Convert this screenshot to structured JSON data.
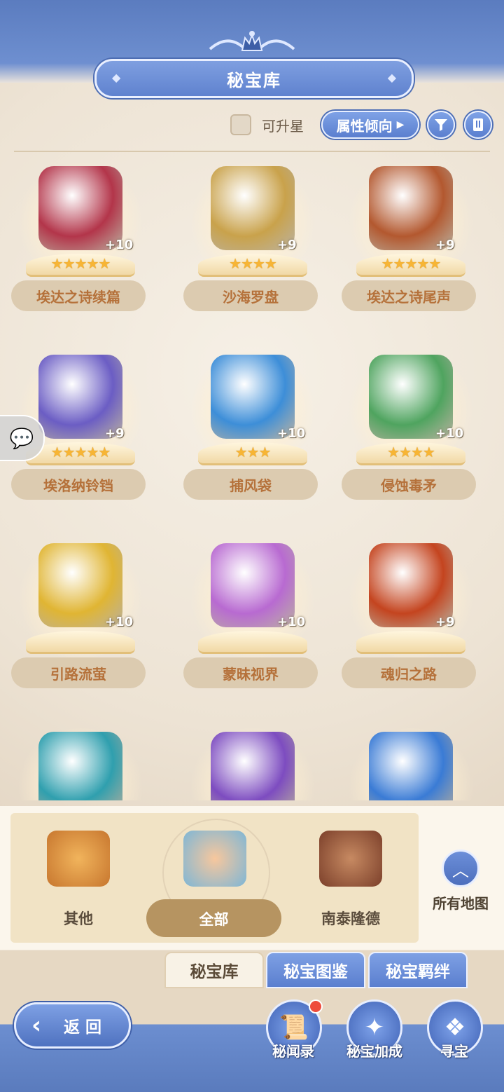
{
  "header": {
    "title": "秘宝库"
  },
  "filters": {
    "upgradable_label": "可升星",
    "attribute_label": "属性倾向",
    "filter_icon": "filter-icon",
    "sort_icon": "bookmark-icon"
  },
  "items": [
    {
      "name": "埃达之诗续篇",
      "level": "+10",
      "stars": "★★★★★",
      "icon": "red-book-icon",
      "color": "#b3354a"
    },
    {
      "name": "沙海罗盘",
      "level": "+9",
      "stars": "★★★★",
      "icon": "compass-icon",
      "color": "#c9a24b"
    },
    {
      "name": "埃达之诗尾声",
      "level": "+9",
      "stars": "★★★★★",
      "icon": "brown-book-icon",
      "color": "#b3582f"
    },
    {
      "name": "埃洛纳铃铛",
      "level": "+9",
      "stars": "★★★★★",
      "icon": "bell-icon",
      "color": "#6b5dc4"
    },
    {
      "name": "捕风袋",
      "level": "+10",
      "stars": "★★★",
      "icon": "wind-bag-icon",
      "color": "#3d8ed8"
    },
    {
      "name": "侵蚀毒矛",
      "level": "+10",
      "stars": "★★★★",
      "icon": "poison-spear-icon",
      "color": "#4fa45f"
    },
    {
      "name": "引路流萤",
      "level": "+10",
      "stars": "",
      "icon": "firefly-icon",
      "color": "#e0b533"
    },
    {
      "name": "蒙昧视界",
      "level": "+10",
      "stars": "",
      "icon": "glasses-icon",
      "color": "#b86ad1"
    },
    {
      "name": "魂归之路",
      "level": "+9",
      "stars": "",
      "icon": "soul-orb-icon",
      "color": "#c4441f"
    },
    {
      "name": "",
      "level": "",
      "stars": "",
      "icon": "teal-book-icon",
      "color": "#2f9fae"
    },
    {
      "name": "",
      "level": "",
      "stars": "",
      "icon": "purple-eye-icon",
      "color": "#7d4cc0"
    },
    {
      "name": "",
      "level": "",
      "stars": "",
      "icon": "potion-icon",
      "color": "#3a7bd5"
    }
  ],
  "regions": [
    {
      "label": "其他",
      "icon": "misc-region-icon",
      "color": "#d98a3a"
    },
    {
      "label": "全部",
      "icon": "house-region-icon",
      "color": "#e08b57"
    },
    {
      "label": "南泰隆德",
      "icon": "ruins-region-icon",
      "color": "#9b5a3c"
    }
  ],
  "all_maps": {
    "label": "所有地图",
    "icon": "chevron-up-icon"
  },
  "tabs": [
    {
      "label": "秘宝库",
      "active": true
    },
    {
      "label": "秘宝图鉴",
      "active": false
    },
    {
      "label": "秘宝羁绊",
      "active": false
    }
  ],
  "bottom": {
    "back_label": "返回",
    "features": [
      {
        "label": "秘闻录",
        "icon": "scroll-icon",
        "badge": true
      },
      {
        "label": "秘宝加成",
        "icon": "sparkle-arrow-icon",
        "badge": false
      },
      {
        "label": "寻宝",
        "icon": "treasure-icon",
        "badge": false
      }
    ]
  },
  "chat": {
    "icon": "chat-bubble-icon"
  }
}
